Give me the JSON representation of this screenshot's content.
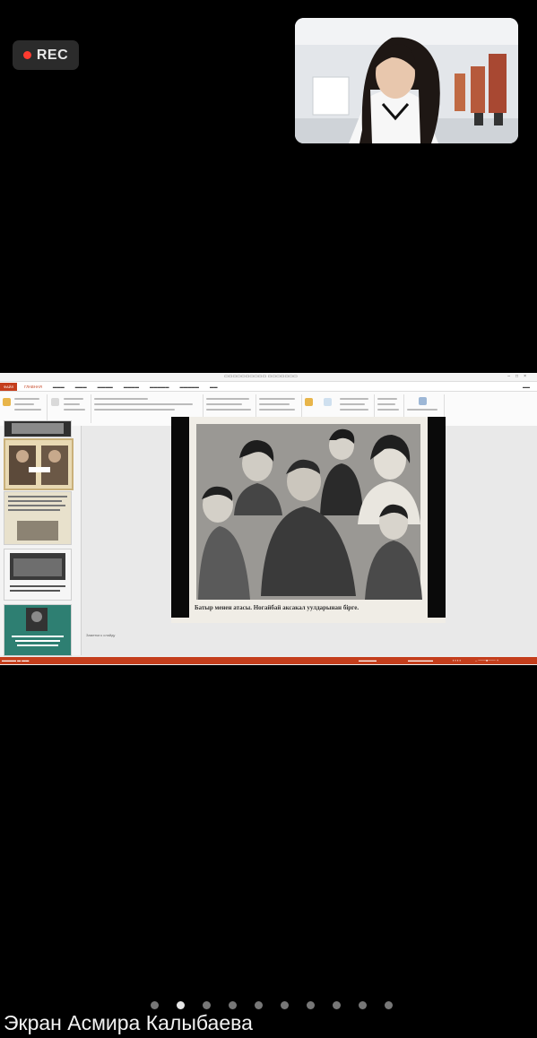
{
  "recording": {
    "label": "REC"
  },
  "presentation": {
    "active_tab": "ГЛАВНАЯ",
    "slide_caption": "Батыр менен атасы. Ногайбай аксакал уулдарынан бірге.",
    "notes_placeholder": "Заметки к слайду"
  },
  "pagination": {
    "total": 10,
    "active_index": 1
  },
  "speaker": {
    "label": "Экран Асмира Калыбаева"
  },
  "colors": {
    "accent": "#c43e1c",
    "rec_dot": "#ff3b30"
  }
}
